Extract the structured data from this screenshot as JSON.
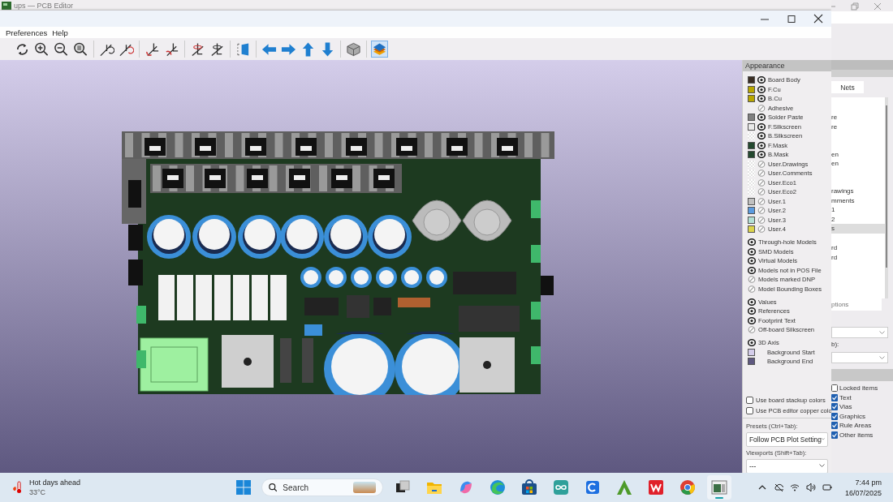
{
  "background_window": {
    "title": "ups — PCB Editor",
    "panel": {
      "tab": "Nets",
      "list_items": [
        {
          "text": "re",
          "selected": false
        },
        {
          "text": "re",
          "selected": false
        },
        {
          "text": "en",
          "selected": false
        },
        {
          "text": "en",
          "selected": false
        },
        {
          "text": "rawings",
          "selected": false
        },
        {
          "text": "mments",
          "selected": false
        },
        {
          "text": "1",
          "selected": false
        },
        {
          "text": "2",
          "selected": false
        },
        {
          "text": "s",
          "selected": true
        },
        {
          "text": "rd",
          "selected": false
        },
        {
          "text": "rd",
          "selected": false
        }
      ],
      "field_text": "ptions",
      "dropdown_label": "b):",
      "checkboxes": [
        {
          "label": "Locked items",
          "checked": false
        },
        {
          "label": "Text",
          "checked": true
        },
        {
          "label": "Vias",
          "checked": true
        },
        {
          "label": "Graphics",
          "checked": true
        },
        {
          "label": "Rule Areas",
          "checked": true
        },
        {
          "label": "Other items",
          "checked": true
        }
      ]
    }
  },
  "viewer": {
    "menu": [
      "Preferences",
      "Help"
    ],
    "toolbar": [
      [
        {
          "selected": false
        },
        {
          "selected": false
        },
        {
          "selected": false
        },
        {
          "selected": false
        }
      ],
      [
        {
          "selected": false
        },
        {
          "selected": false
        }
      ],
      [
        {
          "selected": false
        },
        {
          "selected": false
        }
      ],
      [
        {
          "selected": false
        },
        {
          "selected": false
        }
      ],
      [
        {
          "selected": false
        }
      ],
      [
        {
          "selected": false
        },
        {
          "selected": false
        },
        {
          "selected": false
        },
        {
          "selected": false
        }
      ],
      [
        {
          "selected": false
        }
      ],
      [
        {
          "selected": true
        }
      ]
    ],
    "appearance": {
      "title": "Appearance",
      "groups": [
        {
          "items": [
            {
              "kind": "layer",
              "name": "Board Body",
              "color": "#3a2e24",
              "visible": true
            },
            {
              "kind": "layer",
              "name": "F.Cu",
              "color": "#b8a600",
              "visible": true
            },
            {
              "kind": "layer",
              "name": "B.Cu",
              "color": "#b8a600",
              "visible": true
            },
            {
              "kind": "blank",
              "name": "Adhesive",
              "visible": false
            },
            {
              "kind": "layer",
              "name": "Solder Paste",
              "color": "#808080",
              "visible": true
            },
            {
              "kind": "layer",
              "name": "F.Silkscreen",
              "color": "#eaeaea",
              "visible": true
            },
            {
              "kind": "clear",
              "name": "B.Silkscreen",
              "visible": true
            },
            {
              "kind": "layer",
              "name": "F.Mask",
              "color": "#24492f",
              "visible": true
            },
            {
              "kind": "layer",
              "name": "B.Mask",
              "color": "#24492f",
              "visible": true
            },
            {
              "kind": "clear",
              "name": "User.Drawings",
              "visible": false
            },
            {
              "kind": "clear",
              "name": "User.Comments",
              "visible": false
            },
            {
              "kind": "clear",
              "name": "User.Eco1",
              "visible": false
            },
            {
              "kind": "clear",
              "name": "User.Eco2",
              "visible": false
            },
            {
              "kind": "layer",
              "name": "User.1",
              "color": "#c0c0c0",
              "visible": false
            },
            {
              "kind": "layer",
              "name": "User.2",
              "color": "#5b9be0",
              "visible": false
            },
            {
              "kind": "layer",
              "name": "User.3",
              "color": "#b3e0d6",
              "visible": false
            },
            {
              "kind": "layer",
              "name": "User.4",
              "color": "#dcd44c",
              "visible": false
            }
          ]
        },
        {
          "items": [
            {
              "kind": "object",
              "name": "Through-hole Models",
              "visible": true
            },
            {
              "kind": "object",
              "name": "SMD Models",
              "visible": true
            },
            {
              "kind": "object",
              "name": "Virtual Models",
              "visible": true
            },
            {
              "kind": "object",
              "name": "Models not in POS File",
              "visible": true
            },
            {
              "kind": "object",
              "name": "Models marked DNP",
              "visible": false
            },
            {
              "kind": "object",
              "name": "Model Bounding Boxes",
              "visible": false
            }
          ]
        },
        {
          "items": [
            {
              "kind": "object",
              "name": "Values",
              "visible": true
            },
            {
              "kind": "object",
              "name": "References",
              "visible": true
            },
            {
              "kind": "object",
              "name": "Footprint Text",
              "visible": true
            },
            {
              "kind": "object",
              "name": "Off-board Silkscreen",
              "visible": false
            }
          ]
        },
        {
          "items": [
            {
              "kind": "object",
              "name": "3D Axis",
              "visible": true
            },
            {
              "kind": "background",
              "name": "Background Start",
              "color": "#d4cdea"
            },
            {
              "kind": "background",
              "name": "Background End",
              "color": "#5e5880"
            }
          ]
        }
      ],
      "options": [
        {
          "label": "Use board stackup colors",
          "checked": false
        },
        {
          "label": "Use PCB editor copper colo",
          "checked": false
        }
      ],
      "presets": {
        "label": "Presets (Ctrl+Tab):",
        "value": "Follow PCB Plot Setting"
      },
      "viewports": {
        "label": "Viewports (Shift+Tab):",
        "value": "---"
      }
    }
  },
  "taskbar": {
    "weather": {
      "title": "Hot days ahead",
      "temperature": "33°C"
    },
    "search": {
      "placeholder": "Search"
    },
    "apps": [
      {
        "active": false
      },
      {
        "active": false
      },
      {
        "active": false
      },
      {
        "active": false
      },
      {
        "active": false
      },
      {
        "active": false
      },
      {
        "active": false
      },
      {
        "active": false
      },
      {
        "active": false
      },
      {
        "active": false
      },
      {
        "active": true
      }
    ],
    "time": "7:44 pm",
    "date": "16/07/2025"
  }
}
